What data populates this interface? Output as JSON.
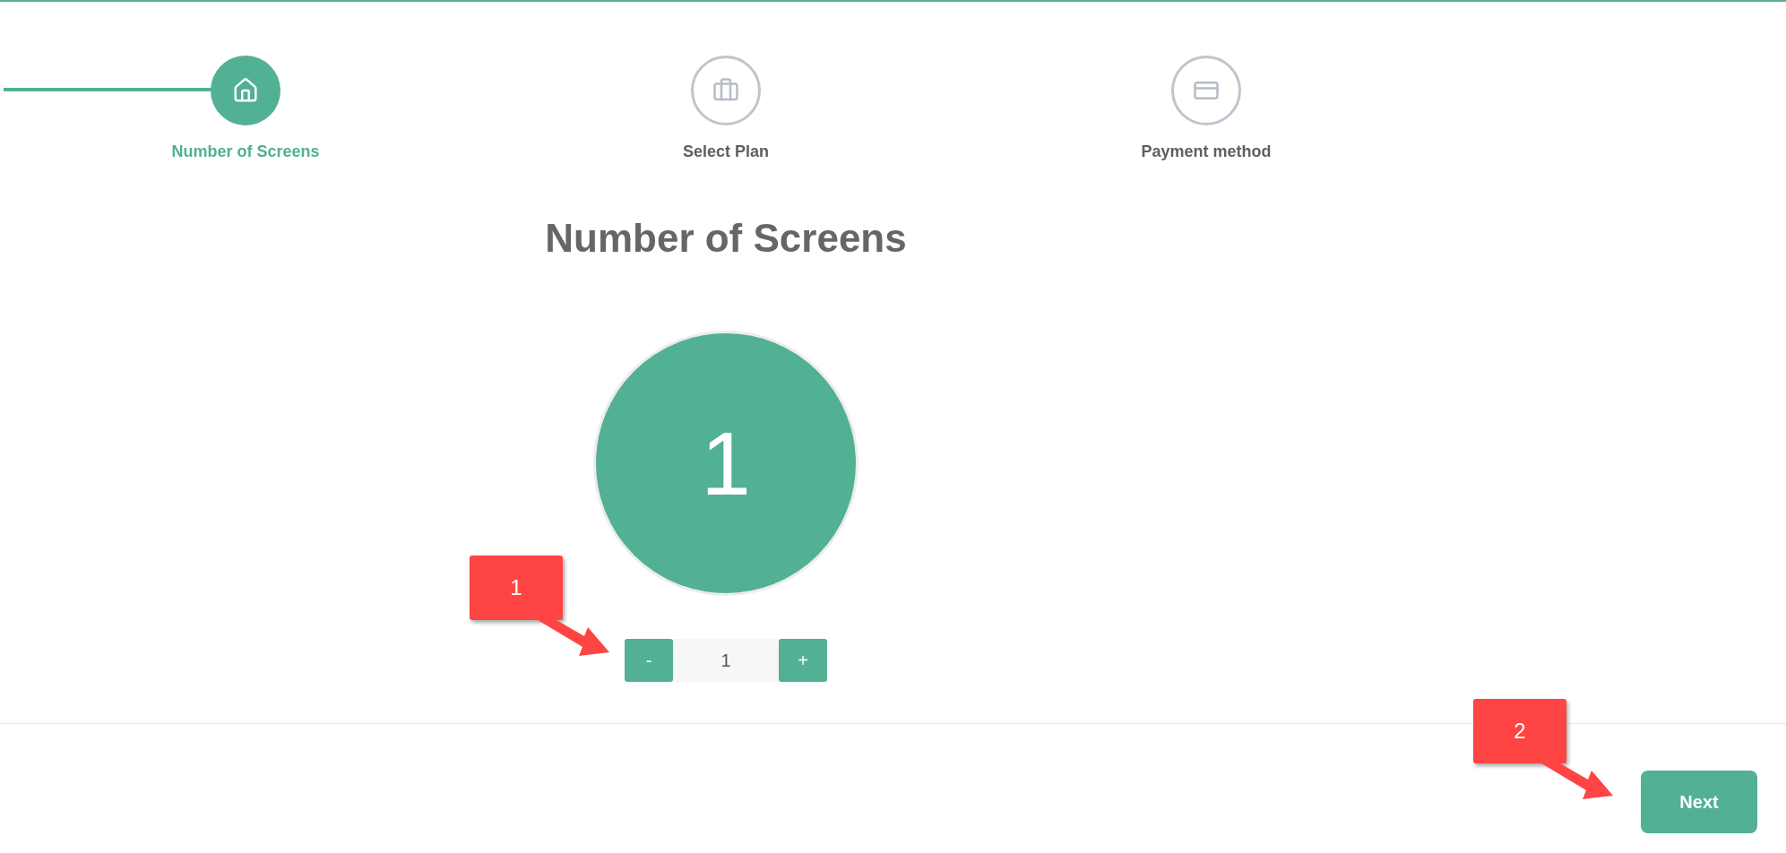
{
  "steps": [
    {
      "label": "Number of Screens",
      "selected": true
    },
    {
      "label": "Select Plan",
      "selected": false
    },
    {
      "label": "Payment method",
      "selected": false
    }
  ],
  "heading": "Number of Screens",
  "screen_count": "1",
  "counter": {
    "decrement": "-",
    "value": "1",
    "increment": "+"
  },
  "next_button": "Next",
  "callouts": [
    {
      "number": "1"
    },
    {
      "number": "2"
    }
  ]
}
